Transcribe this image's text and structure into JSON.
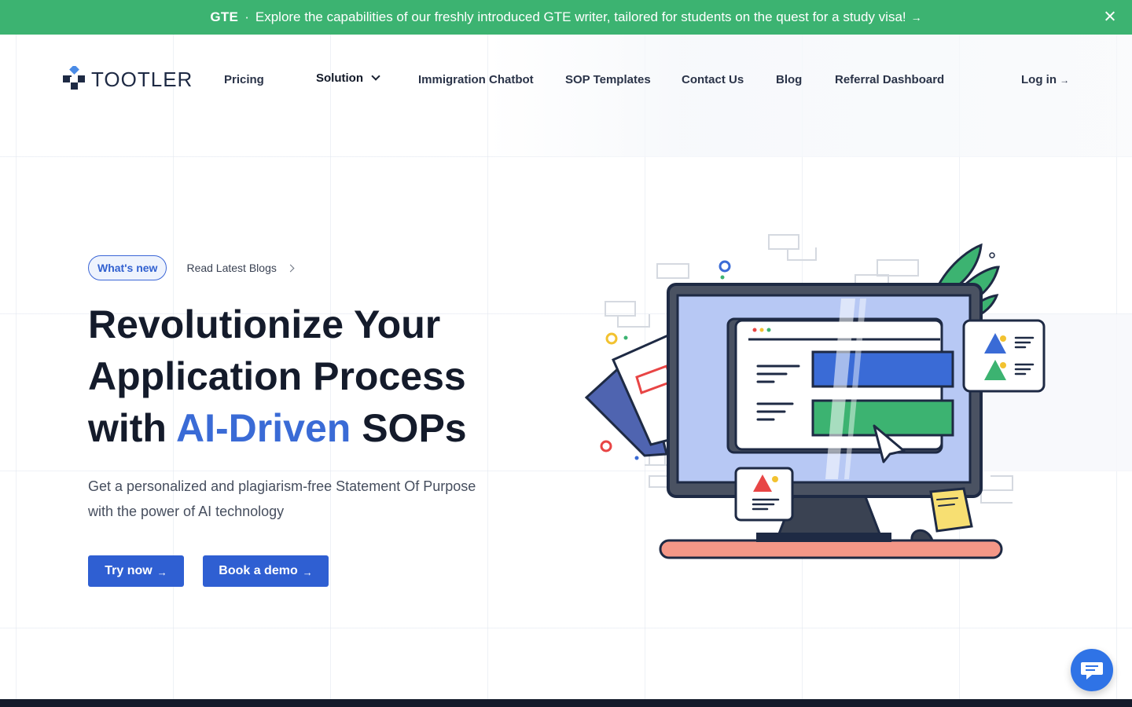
{
  "announcement": {
    "tag": "GTE",
    "separator": "·",
    "message": "Explore the capabilities of our freshly introduced GTE writer, tailored for students on the quest for a study visa!",
    "arrow": "→",
    "background_color": "#3cb371"
  },
  "brand": {
    "logo_text": "TOOTLER",
    "logo_icon": "cross-blocks-logo"
  },
  "nav": {
    "pricing": "Pricing",
    "solution": "Solution",
    "immigration_chatbot": "Immigration Chatbot",
    "sop_templates": "SOP Templates",
    "contact_us": "Contact Us",
    "blog": "Blog",
    "referral_dashboard": "Referral Dashboard",
    "login": "Log in",
    "login_arrow": "→"
  },
  "hero": {
    "pill": "What's new",
    "read_link": "Read Latest Blogs",
    "headline_line1": "Revolutionize Your",
    "headline_line2": "Application Process",
    "headline_with": "with",
    "headline_accent": "AI-Driven",
    "headline_end": "SOPs",
    "subtext": "Get a personalized and plagiarism-free Statement Of Purpose with the power of AI technology",
    "primary_button": "Try now",
    "secondary_button": "Book a demo",
    "button_arrow": "→",
    "accent_color": "#3a6bd6",
    "button_color": "#2f5fd2"
  },
  "chat_widget": {
    "icon": "chat-bubble-icon"
  }
}
